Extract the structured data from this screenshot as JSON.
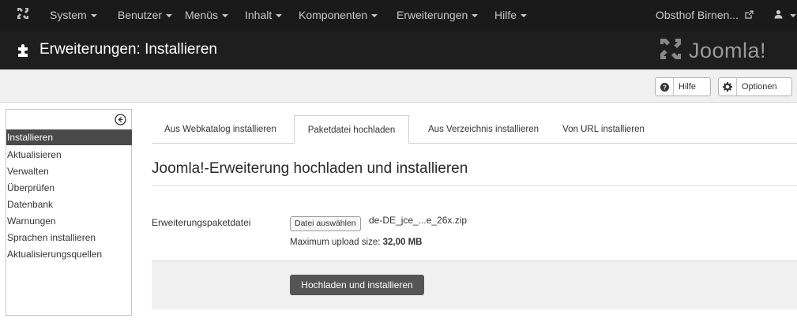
{
  "topnav": {
    "items": [
      "System",
      "Benutzer",
      "Menüs",
      "Inhalt",
      "Komponenten",
      "Erweiterungen",
      "Hilfe"
    ],
    "site_link": "Obsthof Birnen...",
    "logo_icon": "joomla-icon",
    "external_icon": "external-link-icon",
    "user_icon": "user-icon"
  },
  "header": {
    "title": "Erweiterungen: Installieren",
    "title_icon": "puzzle-piece-icon",
    "brand": "Joomla!"
  },
  "toolbar": {
    "help_label": "Hilfe",
    "help_icon": "question-icon",
    "options_label": "Optionen",
    "options_icon": "gear-icon"
  },
  "sidebar": {
    "toggle_icon": "collapse-arrow-icon",
    "items": [
      "Installieren",
      "Aktualisieren",
      "Verwalten",
      "Überprüfen",
      "Datenbank",
      "Warnungen",
      "Sprachen installieren",
      "Aktualisierungsquellen"
    ],
    "active_index": 0
  },
  "tabs": [
    "Aus Webkatalog installieren",
    "Paketdatei hochladen",
    "Aus Verzeichnis installieren",
    "Von URL installieren"
  ],
  "active_tab": 1,
  "main": {
    "heading": "Joomla!-Erweiterung hochladen und installieren",
    "field_label": "Erweiterungspaketdatei",
    "file_button": "Datei auswählen",
    "file_name": "de-DE_jce_...e_26x.zip",
    "max_upload_label": "Maximum upload size: ",
    "max_upload_value": "32,00 MB",
    "submit_label": "Hochladen und installieren"
  }
}
